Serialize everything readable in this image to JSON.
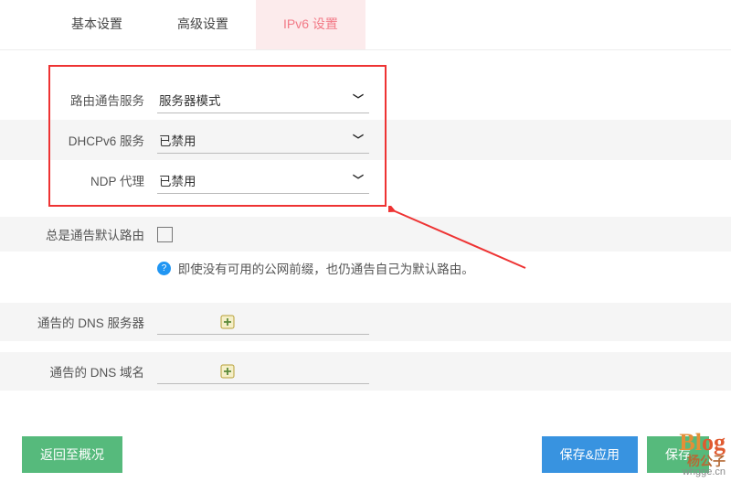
{
  "tabs": {
    "basic": "基本设置",
    "advanced": "高级设置",
    "ipv6": "IPv6 设置"
  },
  "fields": {
    "ra_service": {
      "label": "路由通告服务",
      "value": "服务器模式"
    },
    "dhcpv6_service": {
      "label": "DHCPv6 服务",
      "value": "已禁用"
    },
    "ndp_proxy": {
      "label": "NDP 代理",
      "value": "已禁用"
    },
    "always_default_route": {
      "label": "总是通告默认路由"
    },
    "default_route_help": "即使没有可用的公网前缀，也仍通告自己为默认路由。",
    "dns_server": {
      "label": "通告的 DNS 服务器",
      "value": ""
    },
    "dns_domain": {
      "label": "通告的 DNS 域名",
      "value": ""
    }
  },
  "buttons": {
    "back": "返回至概况",
    "save_apply": "保存&应用",
    "save": "保存"
  },
  "watermark": {
    "blog": "Blog",
    "cn": "杨公子",
    "url": "whgge.cn"
  }
}
